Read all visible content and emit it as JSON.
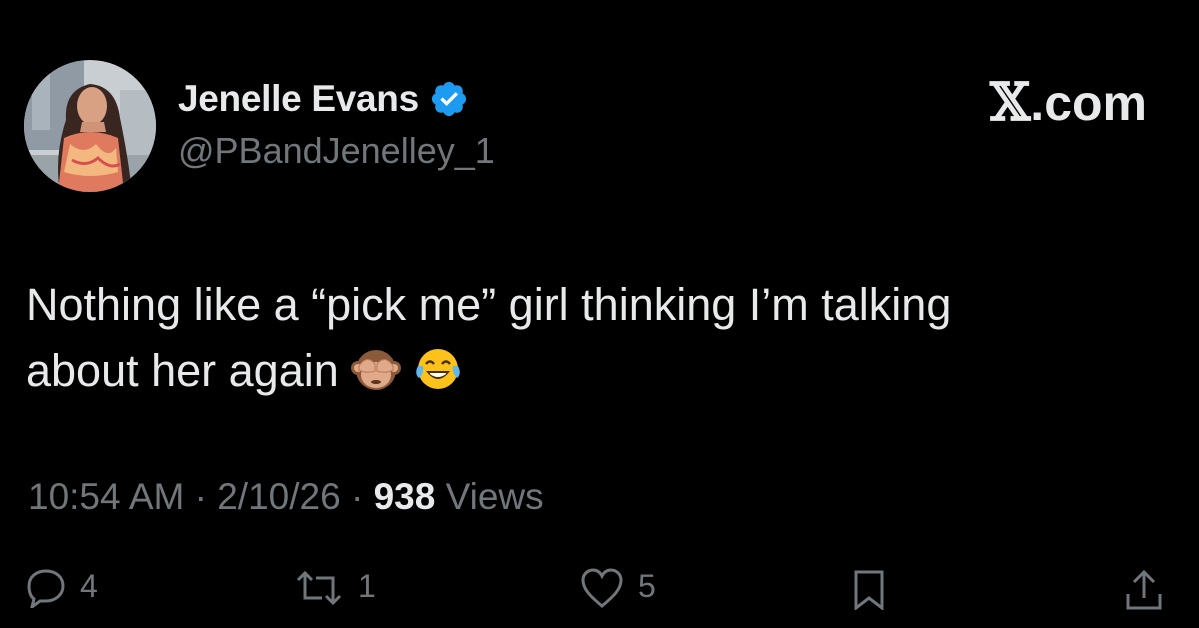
{
  "author": {
    "display_name": "Jenelle Evans",
    "handle": "@PBandJenelley_1",
    "verified": true,
    "verified_color": "#1d9bf0"
  },
  "brand": {
    "mark": "𝕏",
    "suffix": ".com"
  },
  "tweet": {
    "line1": "Nothing like a “pick me” girl thinking I’m talking",
    "line2": "about her again",
    "emojis": [
      "see-no-evil-monkey",
      "face-with-tears-of-joy"
    ]
  },
  "meta": {
    "time": "10:54 AM",
    "separator": "·",
    "date": "2/10/26",
    "views_count": "938",
    "views_label": "Views"
  },
  "actions": {
    "replies": "4",
    "reposts": "1",
    "likes": "5"
  },
  "colors": {
    "background": "#000000",
    "primary_text": "#e7e9ea",
    "secondary_text": "#71767b"
  }
}
